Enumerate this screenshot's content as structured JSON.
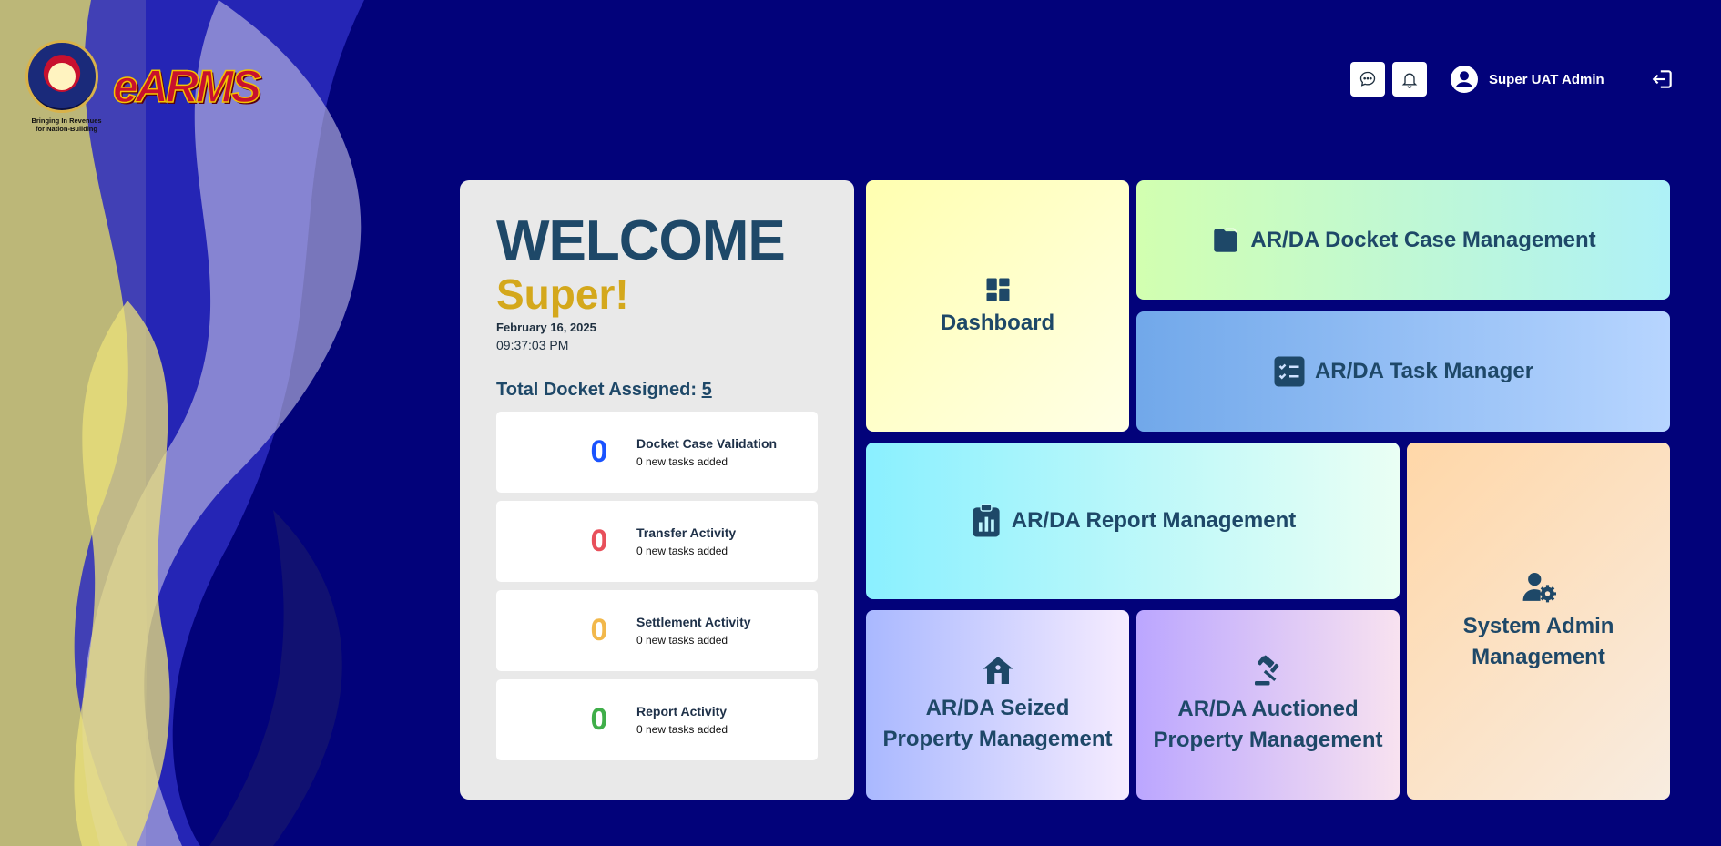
{
  "brand": {
    "app_name": "eARMS",
    "tagline_line1": "Bringing In Revenues",
    "tagline_line2": "for Nation-Building",
    "seal": "BUREAU OF INTERNAL REVENUE PHILIPPINES"
  },
  "header": {
    "chat_icon": "chat-bubble-icon",
    "notification_icon": "bell-icon",
    "user_name": "Super UAT Admin",
    "logout_icon": "logout-icon"
  },
  "welcome": {
    "title": "WELCOME",
    "name": "Super!",
    "date": "February 16, 2025",
    "time": "09:37:03 PM",
    "total_label": "Total Docket Assigned:",
    "total_value": "5",
    "tasks": [
      {
        "count": "0",
        "title": "Docket Case Validation",
        "subtitle": "0 new tasks added",
        "color": "#1a53ff"
      },
      {
        "count": "0",
        "title": "Transfer Activity",
        "subtitle": "0 new tasks added",
        "color": "#e8505b"
      },
      {
        "count": "0",
        "title": "Settlement Activity",
        "subtitle": "0 new tasks added",
        "color": "#f2b84b"
      },
      {
        "count": "0",
        "title": "Report Activity",
        "subtitle": "0 new tasks added",
        "color": "#3fae49"
      }
    ]
  },
  "tiles": {
    "dashboard": {
      "label": "Dashboard",
      "icon": "dashboard-grid-icon"
    },
    "docket": {
      "label": "AR/DA Docket Case Management",
      "icon": "folder-icon"
    },
    "task_manager": {
      "label": "AR/DA Task Manager",
      "icon": "checklist-icon"
    },
    "report": {
      "label": "AR/DA Report Management",
      "icon": "clipboard-chart-icon"
    },
    "system_admin": {
      "label_line1": "System Admin",
      "label_line2": "Management",
      "icon": "user-gear-icon"
    },
    "seized": {
      "label_line1": "AR/DA Seized",
      "label_line2": "Property Management",
      "icon": "house-icon"
    },
    "auctioned": {
      "label_line1": "AR/DA Auctioned",
      "label_line2": "Property Management",
      "icon": "gavel-icon"
    }
  },
  "colors": {
    "background": "#02027a",
    "heading": "#1e4868",
    "accent_gold": "#d4a81c"
  }
}
